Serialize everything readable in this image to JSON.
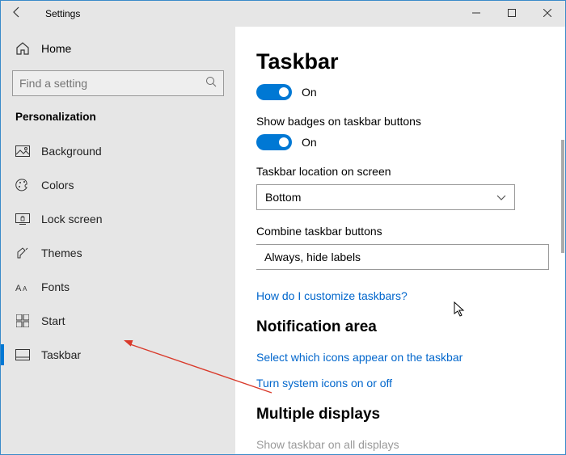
{
  "window": {
    "title": "Settings"
  },
  "sidebar": {
    "home": "Home",
    "searchPlaceholder": "Find a setting",
    "section": "Personalization",
    "items": [
      {
        "label": "Background"
      },
      {
        "label": "Colors"
      },
      {
        "label": "Lock screen"
      },
      {
        "label": "Themes"
      },
      {
        "label": "Fonts"
      },
      {
        "label": "Start"
      },
      {
        "label": "Taskbar"
      }
    ]
  },
  "main": {
    "title": "Taskbar",
    "toggle1State": "On",
    "badgesLabel": "Show badges on taskbar buttons",
    "badgesState": "On",
    "locationLabel": "Taskbar location on screen",
    "locationValue": "Bottom",
    "combineLabel": "Combine taskbar buttons",
    "combineValue": "Always, hide labels",
    "helpLink": "How do I customize taskbars?",
    "notifHeading": "Notification area",
    "notifLink1": "Select which icons appear on the taskbar",
    "notifLink2": "Turn system icons on or off",
    "multiHeading": "Multiple displays",
    "multiFaded": "Show taskbar on all displays"
  }
}
